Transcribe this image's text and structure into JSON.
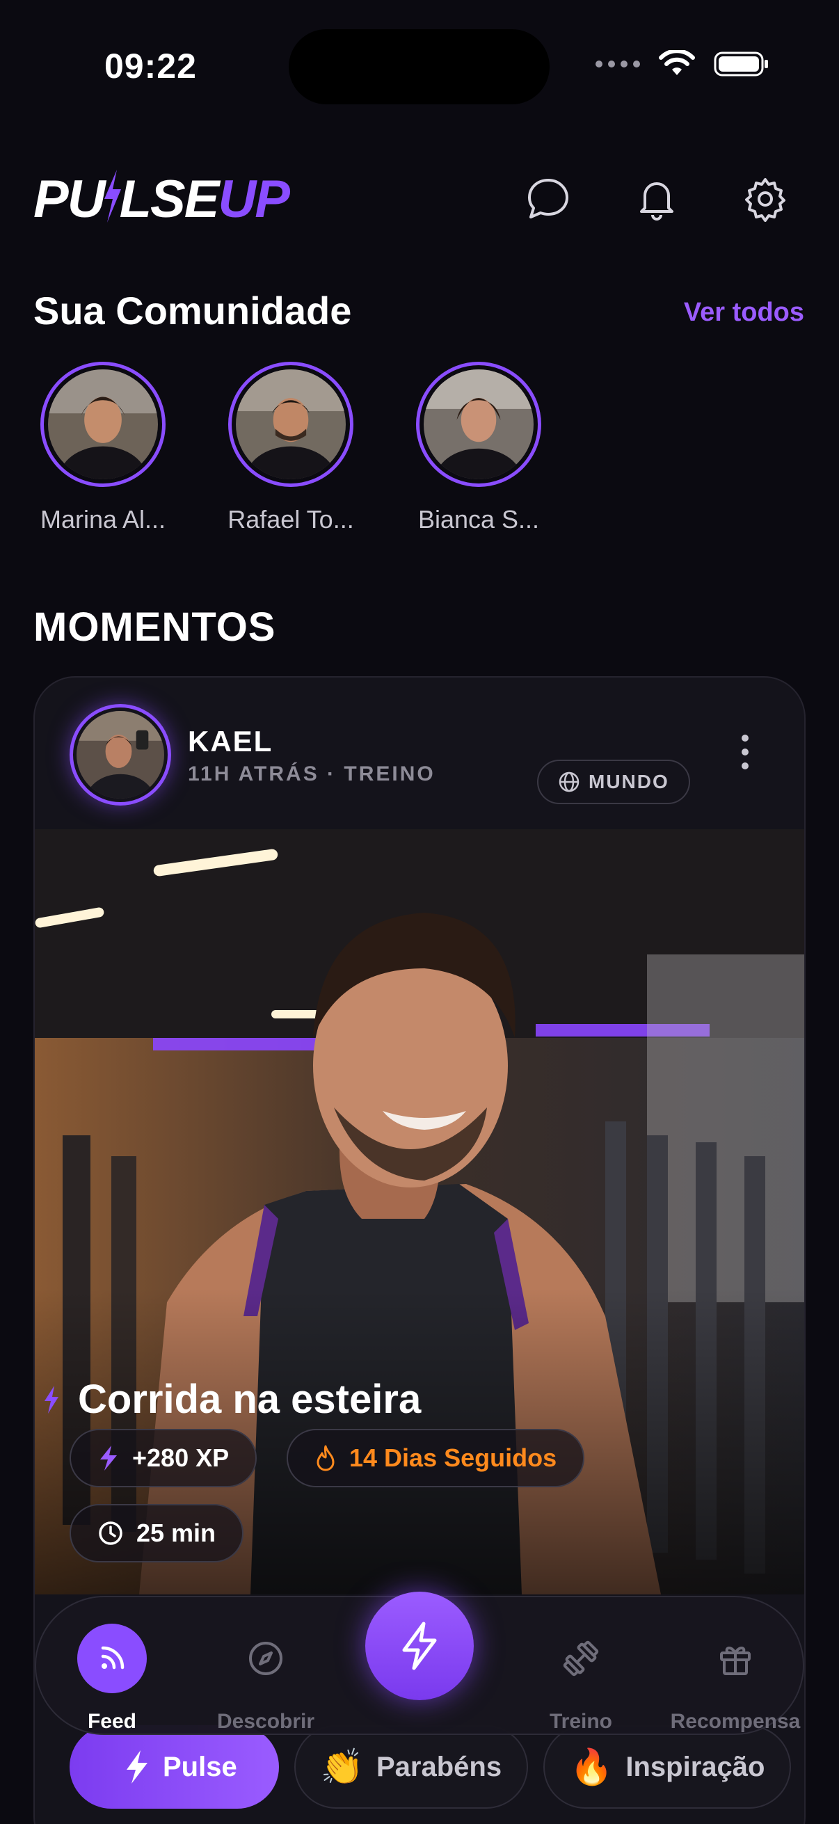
{
  "status_bar": {
    "time": "09:22"
  },
  "header": {
    "logo_part1": "PU",
    "logo_part2": "LSE",
    "logo_part3": "UP",
    "icons": [
      "chat-icon",
      "bell-icon",
      "gear-icon"
    ]
  },
  "community": {
    "title": "Sua Comunidade",
    "see_all": "Ver todos",
    "friends": [
      {
        "name": "Marina Al..."
      },
      {
        "name": "Rafael To..."
      },
      {
        "name": "Bianca S..."
      }
    ]
  },
  "moments": {
    "title": "MOMENTOS"
  },
  "post": {
    "author": "KAEL",
    "meta": "11H ATRÁS · TREINO",
    "scope": "MUNDO",
    "workout": "Corrida na esteira",
    "xp": "+280 XP",
    "streak": "14 Dias Seguidos",
    "duration": "25 min",
    "reactions": [
      "Pulse",
      "Parabéns",
      "Inspiração"
    ]
  },
  "nav": {
    "items": [
      {
        "label": "Feed",
        "icon": "feed-icon"
      },
      {
        "label": "Descobrir",
        "icon": "compass-icon"
      },
      {
        "label": "Treino",
        "icon": "dumbbell-icon"
      },
      {
        "label": "Recompensa",
        "icon": "gift-icon"
      }
    ],
    "fab_icon": "bolt-icon"
  },
  "colors": {
    "accent": "#8a4dff",
    "streak": "#ff8a1d",
    "background": "#0b0a11"
  }
}
